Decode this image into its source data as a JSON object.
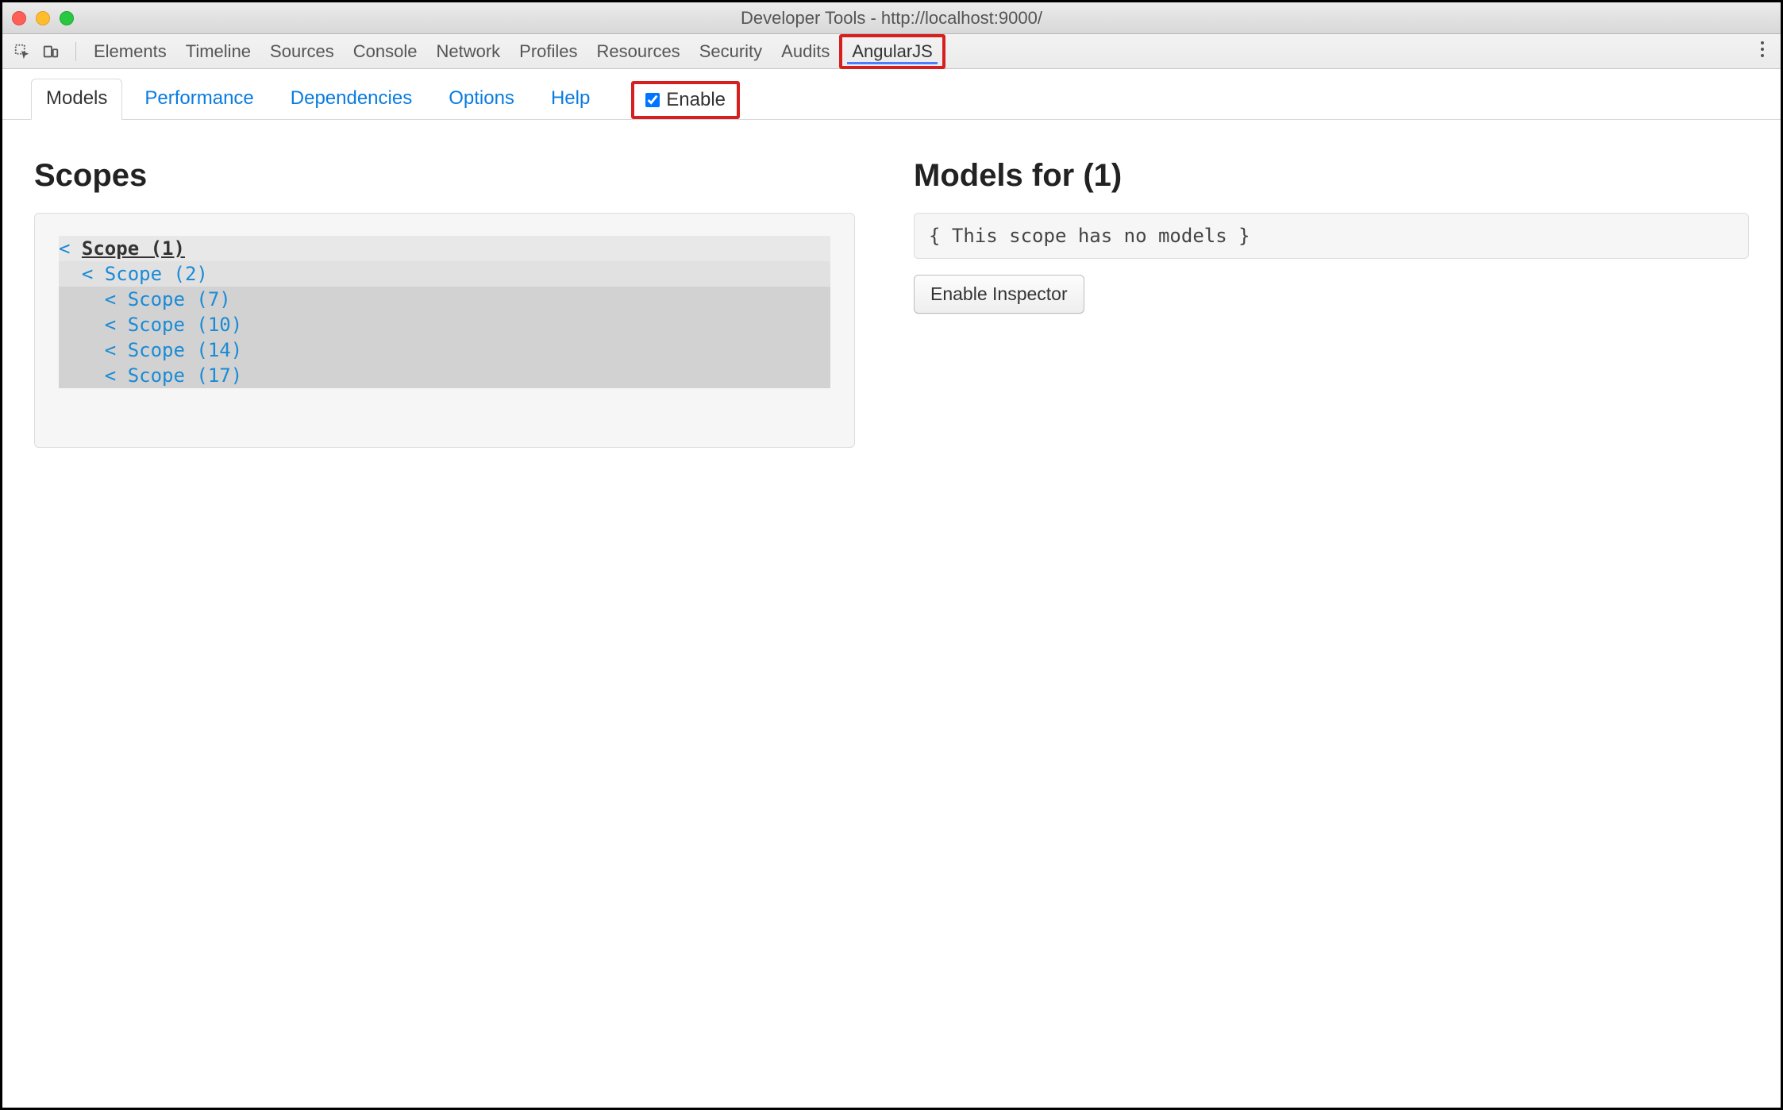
{
  "window": {
    "title": "Developer Tools - http://localhost:9000/"
  },
  "panels": {
    "items": [
      "Elements",
      "Timeline",
      "Sources",
      "Console",
      "Network",
      "Profiles",
      "Resources",
      "Security",
      "Audits",
      "AngularJS"
    ],
    "active": "AngularJS"
  },
  "subtabs": {
    "items": [
      "Models",
      "Performance",
      "Dependencies",
      "Options",
      "Help"
    ],
    "active": "Models",
    "enable_label": "Enable",
    "enable_checked": true
  },
  "scopes": {
    "title": "Scopes",
    "tree": [
      {
        "indent": 0,
        "label": "Scope (1)",
        "style": "root"
      },
      {
        "indent": 1,
        "label": "Scope (2)",
        "style": "level1"
      },
      {
        "indent": 2,
        "label": "Scope (7)",
        "style": "child"
      },
      {
        "indent": 2,
        "label": "Scope (10)",
        "style": "child"
      },
      {
        "indent": 2,
        "label": "Scope (14)",
        "style": "child"
      },
      {
        "indent": 2,
        "label": "Scope (17)",
        "style": "child"
      }
    ]
  },
  "models": {
    "title": "Models for (1)",
    "body": "{ This scope has no models }",
    "inspector_button": "Enable Inspector"
  }
}
